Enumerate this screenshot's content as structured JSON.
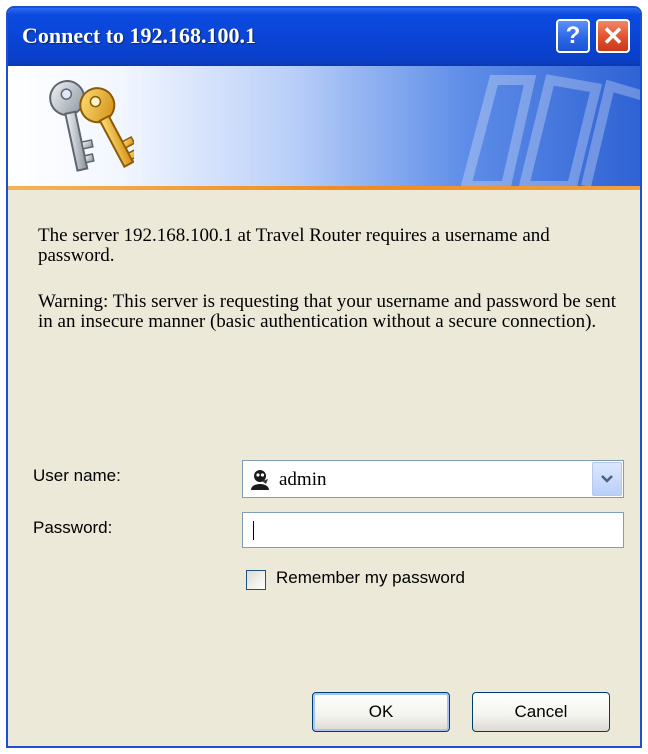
{
  "dialog": {
    "title": "Connect to 192.168.100.1",
    "help_glyph": "?",
    "close_glyph": "✕"
  },
  "message": {
    "line1": "The server 192.168.100.1 at Travel Router requires a username and password.",
    "line2": "Warning: This server is requesting that your username and password be sent in an insecure manner (basic authentication without a secure connection)."
  },
  "form": {
    "username_label": "User name:",
    "username_value": "admin",
    "password_label": "Password:",
    "password_value": "",
    "remember_label": "Remember my password",
    "remember_checked": false
  },
  "buttons": {
    "ok_label": "OK",
    "cancel_label": "Cancel"
  },
  "icons": {
    "banner": "keys-icon",
    "user": "user-icon",
    "dropdown": "chevron-down-icon"
  },
  "colors": {
    "titlebar": "#0b45d6",
    "dialog_bg": "#ece9d8",
    "banner_accent": "#f08a1e"
  }
}
